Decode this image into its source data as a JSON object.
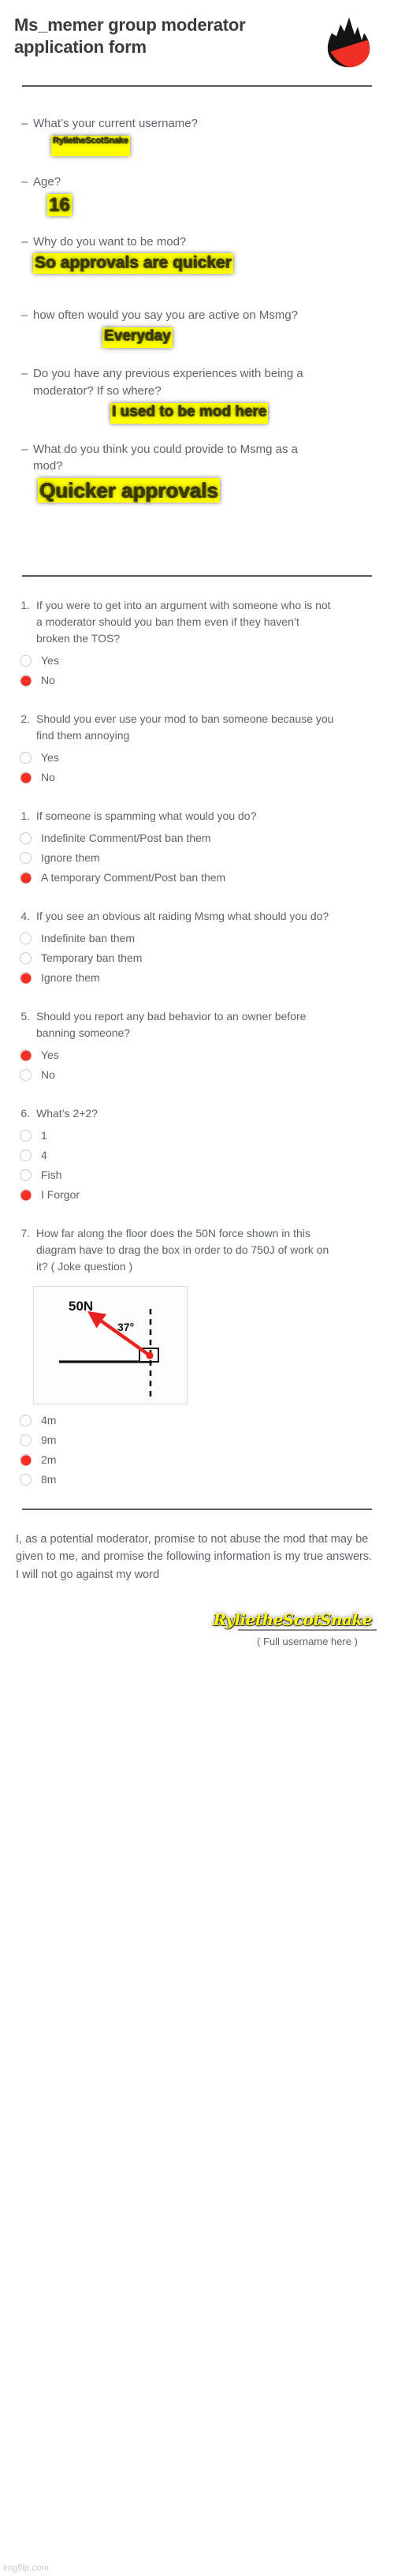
{
  "header": {
    "title": "Ms_memer group moderator application form",
    "logo_icon": "flame-icon"
  },
  "open_questions": [
    {
      "bullet": "–",
      "question": "What’s your current username?",
      "answer": "RyliethеScotSnake"
    },
    {
      "bullet": "–",
      "question": "Age?",
      "answer": "16"
    },
    {
      "bullet": "–",
      "question": "Why do you want to be mod?",
      "answer": "So approvals are quicker"
    },
    {
      "bullet": "–",
      "question": "how often would you say you are active on Msmg?",
      "answer": "Everyday"
    },
    {
      "bullet": "–",
      "question": "Do you have any previous experiences with being a moderator? If so where?",
      "answer": "I used to be mod here"
    },
    {
      "bullet": "–",
      "question": "What do you think you could provide to Msmg as a mod?",
      "answer": "Quicker approvals"
    }
  ],
  "mc_questions": [
    {
      "number": "1.",
      "question": "If you were to get into an argument with someone who is not a moderator should you ban them even if they haven’t broken the TOS?",
      "options": [
        {
          "label": "Yes",
          "selected": false
        },
        {
          "label": "No",
          "selected": true
        }
      ]
    },
    {
      "number": "2.",
      "question": "Should you ever use your mod to ban someone because you find them annoying",
      "options": [
        {
          "label": "Yes",
          "selected": false
        },
        {
          "label": "No",
          "selected": true
        }
      ]
    },
    {
      "number": "1.",
      "question": "If someone is spamming what would you do?",
      "options": [
        {
          "label": "Indefinite Comment/Post ban them",
          "selected": false
        },
        {
          "label": "Ignore them",
          "selected": false
        },
        {
          "label": "A temporary Comment/Post ban them",
          "selected": true
        }
      ]
    },
    {
      "number": "4.",
      "question": "If you see an obvious alt raiding Msmg what should you do?",
      "options": [
        {
          "label": "Indefinite ban them",
          "selected": false
        },
        {
          "label": "Temporary ban them",
          "selected": false
        },
        {
          "label": "Ignore them",
          "selected": true
        }
      ]
    },
    {
      "number": "5.",
      "question": "Should you report any bad behavior to an owner before banning someone?",
      "options": [
        {
          "label": "Yes",
          "selected": true
        },
        {
          "label": "No",
          "selected": false
        }
      ]
    },
    {
      "number": "6.",
      "question": "What’s 2+2?",
      "options": [
        {
          "label": "1",
          "selected": false
        },
        {
          "label": "4",
          "selected": false
        },
        {
          "label": "Fish",
          "selected": false
        },
        {
          "label": "I Forgor",
          "selected": true
        }
      ]
    },
    {
      "number": "7.",
      "question": "How far along the floor does the 50N force shown in this diagram have to drag the box in order to do 750J of work on it? ( Joke question )",
      "options": [
        {
          "label": "4m",
          "selected": false
        },
        {
          "label": "9m",
          "selected": false
        },
        {
          "label": "2m",
          "selected": true
        },
        {
          "label": "8m",
          "selected": false
        }
      ]
    }
  ],
  "diagram": {
    "force_label": "50N",
    "angle_label": "37°",
    "arrow_color": "#e8231f",
    "line_color": "#111111"
  },
  "pledge": {
    "text": "I, as a potential moderator, promise to not abuse the mod that may be given to me, and promise the following information is my true answers. I will not go against my word",
    "signature": "RyliethеScotSnake",
    "caption": "( Full username here )"
  },
  "watermark": "imgflip.com",
  "colors": {
    "accent_red": "#f72f24",
    "highlight_yellow": "#ffff00",
    "text_gray": "#5f6368"
  }
}
